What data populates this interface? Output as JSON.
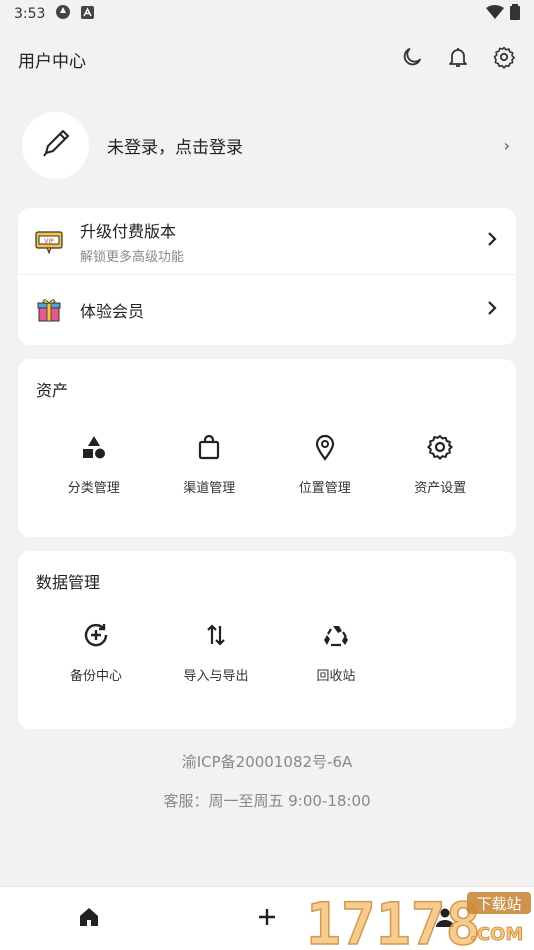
{
  "status": {
    "time": "3:53"
  },
  "header": {
    "title": "用户中心"
  },
  "login": {
    "label": "未登录，点击登录",
    "chevron": "›"
  },
  "upgrade": {
    "items": [
      {
        "title": "升级付费版本",
        "subtitle": "解锁更多高级功能",
        "icon": "vip-ticket-icon"
      },
      {
        "title": "体验会员",
        "icon": "gift-box-icon"
      }
    ]
  },
  "assets": {
    "title": "资产",
    "items": [
      {
        "label": "分类管理",
        "icon": "shapes-icon"
      },
      {
        "label": "渠道管理",
        "icon": "shopping-bag-icon"
      },
      {
        "label": "位置管理",
        "icon": "location-pin-icon"
      },
      {
        "label": "资产设置",
        "icon": "gear-icon"
      }
    ]
  },
  "data_mgmt": {
    "title": "数据管理",
    "items": [
      {
        "label": "备份中心",
        "icon": "backup-icon"
      },
      {
        "label": "导入与导出",
        "icon": "import-export-icon"
      },
      {
        "label": "回收站",
        "icon": "recycle-icon"
      }
    ]
  },
  "footer": {
    "icp": "渝ICP备20001082号-6A",
    "service": "客服：周一至周五 9:00-18:00"
  },
  "watermark": {
    "text": "17178",
    "sub": "下载站",
    "domain": ".COM"
  }
}
